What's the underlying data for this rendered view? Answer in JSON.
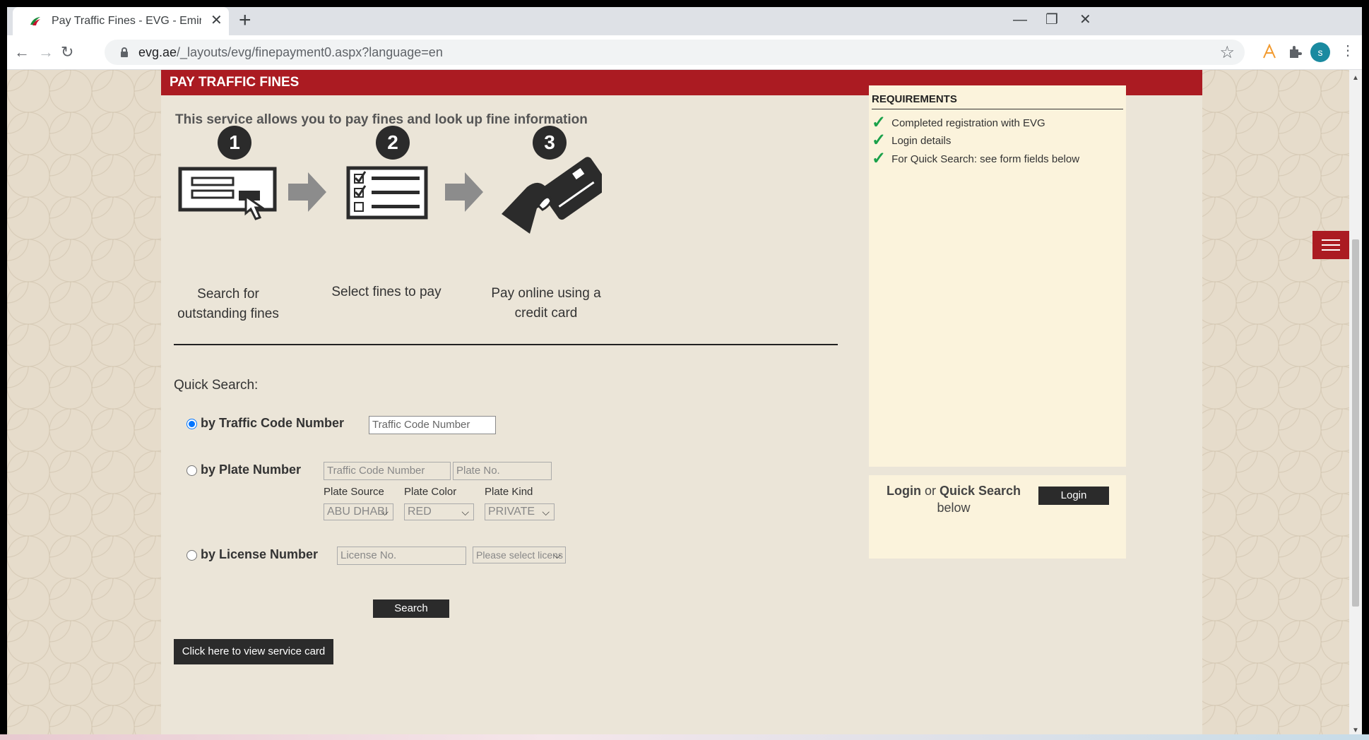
{
  "browser": {
    "tab_title": "Pay Traffic Fines - EVG - Emirates",
    "url_host": "evg.ae",
    "url_path": "/_layouts/evg/finepayment0.aspx?language=en",
    "avatar_letter": "s"
  },
  "page": {
    "header": "PAY TRAFFIC FINES",
    "intro": "This service allows you to pay fines and look up fine information",
    "steps": [
      {
        "num": "1",
        "label": "Search for outstanding fines"
      },
      {
        "num": "2",
        "label": "Select fines to pay"
      },
      {
        "num": "3",
        "label": "Pay online using a credit card"
      }
    ],
    "quick_search_title": "Quick Search:",
    "options": {
      "traffic_code": {
        "label": "by Traffic Code Number",
        "placeholder": "Traffic Code Number",
        "selected": true
      },
      "plate": {
        "label": "by Plate Number",
        "traffic_code_placeholder": "Traffic Code Number",
        "plate_placeholder": "Plate No.",
        "source_label": "Plate Source",
        "source_value": "ABU DHABI",
        "color_label": "Plate Color",
        "color_value": "RED",
        "kind_label": "Plate Kind",
        "kind_value": "PRIVATE"
      },
      "license": {
        "label": "by License Number",
        "placeholder": "License No.",
        "select_value": "Please select licens"
      }
    },
    "search_button": "Search",
    "service_card_button": "Click here to view service card"
  },
  "requirements": {
    "title": "REQUIREMENTS",
    "items": [
      "Completed registration with EVG",
      "Login details",
      "For Quick Search: see form fields below"
    ]
  },
  "login_panel": {
    "login_word": "Login",
    "or_word": "or",
    "quick_search_word": "Quick Search",
    "below_word": "below",
    "button": "Login"
  },
  "colors": {
    "brand_red": "#ab1b22",
    "background": "#ebe5d8",
    "panel": "#fbf3dc",
    "check_green": "#1aa14a"
  }
}
